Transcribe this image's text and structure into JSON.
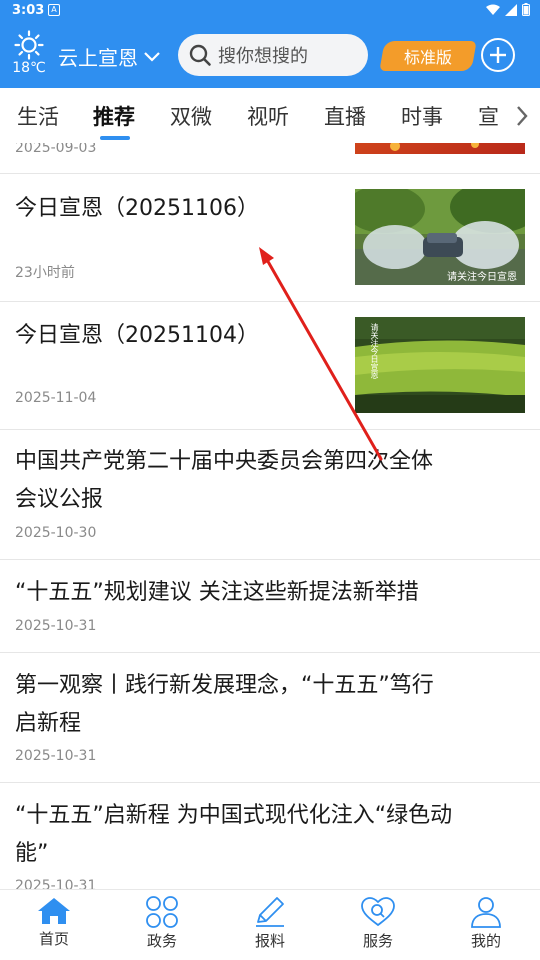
{
  "status_bar": {
    "time": "3:03",
    "notification": "A"
  },
  "header": {
    "temperature": "18℃",
    "city": "云上宣恩",
    "search_placeholder": "搜你想搜的",
    "edition_label": "标准版",
    "accent_color": "#2f8ff0",
    "edition_color": "#f39c2a"
  },
  "tabs": [
    {
      "label": "生活",
      "active": false
    },
    {
      "label": "推荐",
      "active": true
    },
    {
      "label": "双微",
      "active": false
    },
    {
      "label": "视听",
      "active": false
    },
    {
      "label": "直播",
      "active": false
    },
    {
      "label": "时事",
      "active": false
    },
    {
      "label": "宣",
      "active": false
    }
  ],
  "feed": [
    {
      "title": "",
      "date": "2025-09-03",
      "has_thumb": true
    },
    {
      "title": "今日宣恩（20251106）",
      "date": "23小时前",
      "has_thumb": true,
      "thumb_caption": "请关注今日宣恩"
    },
    {
      "title": "今日宣恩（20251104）",
      "date": "2025-11-04",
      "has_thumb": true,
      "thumb_caption": "请关注今日宣恩"
    },
    {
      "title_line1": "中国共产党第二十届中央委员会第四次全体",
      "title_line2": "会议公报",
      "date": "2025-10-30"
    },
    {
      "title": "“十五五”规划建议 关注这些新提法新举措",
      "date": "2025-10-31"
    },
    {
      "title_line1": "第一观察丨践行新发展理念，“十五五”笃行",
      "title_line2": "启新程",
      "date": "2025-10-31"
    },
    {
      "title_line1": "“十五五”启新程 为中国式现代化注入“绿色动",
      "title_line2": "能”",
      "date": "2025-10-31"
    }
  ],
  "bottom_nav": [
    {
      "label": "首页",
      "icon": "home-icon",
      "active": true
    },
    {
      "label": "政务",
      "icon": "government-icon",
      "active": false
    },
    {
      "label": "报料",
      "icon": "pencil-icon",
      "active": false
    },
    {
      "label": "服务",
      "icon": "service-icon",
      "active": false
    },
    {
      "label": "我的",
      "icon": "profile-icon",
      "active": false
    }
  ]
}
